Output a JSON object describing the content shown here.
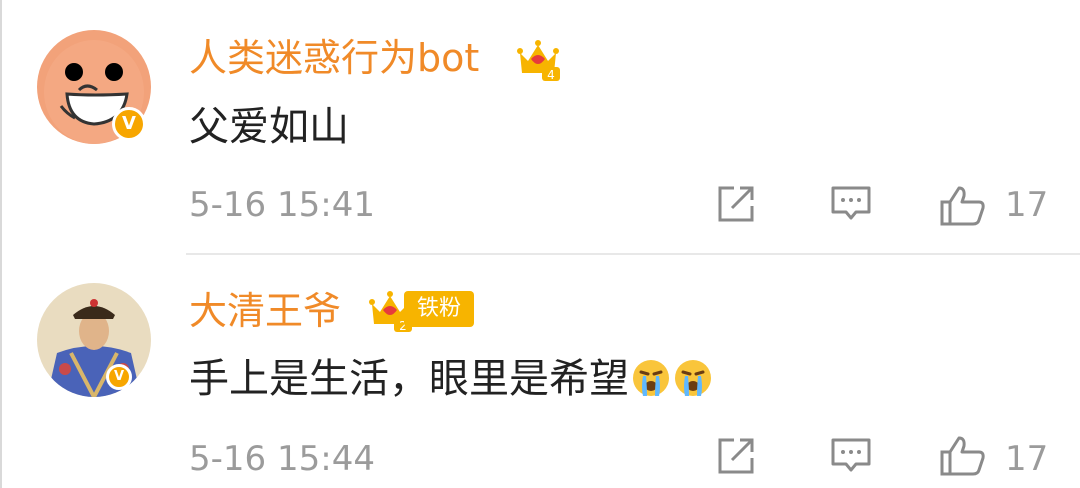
{
  "comments": [
    {
      "username": "人类迷惑行为bot",
      "crown_level": "4",
      "verified": "V",
      "text": "父爱如山",
      "timestamp": "5-16 15:41",
      "likes": "17"
    },
    {
      "username": "大清王爷",
      "crown_level": "2",
      "fan_badge": "铁粉",
      "verified": "V",
      "text": "手上是生活，眼里是希望",
      "emojis": [
        "crying-emoji",
        "crying-emoji"
      ],
      "timestamp": "5-16 15:44",
      "likes": "17"
    }
  ],
  "colors": {
    "username": "#f08a28",
    "badge": "#f7b400",
    "meta": "#9b9b9b"
  }
}
